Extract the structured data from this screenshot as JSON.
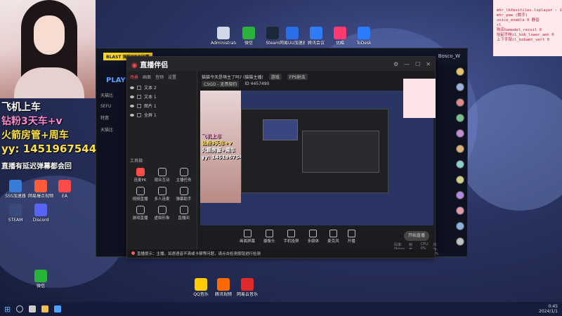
{
  "overlay_text": {
    "line1": "飞机上车",
    "line2": "钻粉3天车+v",
    "line3": "火箭房管+周车",
    "line4": "yy: 1451967544",
    "line5": "直播有延迟弹幕都会回"
  },
  "desktop_icons": [
    {
      "label": "Administrator",
      "color": "#cfd8e6"
    },
    {
      "label": "微信",
      "color": "#2ab33a"
    },
    {
      "label": "Steam",
      "color": "#1b2838"
    },
    {
      "label": "网易UU加速器",
      "color": "#2a6ee8"
    },
    {
      "label": "腾讯会议",
      "color": "#2f7cf6"
    },
    {
      "label": "优酷",
      "color": "#ff3a70"
    },
    {
      "label": "ToDesk",
      "color": "#2a7cff"
    },
    {
      "label": "SSS加速器",
      "color": "#3a7dd8"
    },
    {
      "label": "网易爆点视频",
      "color": "#ff5a3a"
    },
    {
      "label": "EA",
      "color": "#ff4a4a"
    },
    {
      "label": "STEAM",
      "color": "#3a4a7a"
    },
    {
      "label": "Discord",
      "color": "#5865f2"
    },
    {
      "label": "微信",
      "color": "#2ab33a"
    },
    {
      "label": "QQ音乐",
      "color": "#ffcc00"
    },
    {
      "label": "腾讯视频",
      "color": "#ff6a00"
    },
    {
      "label": "网易云音乐",
      "color": "#e02a2a"
    }
  ],
  "main_window": {
    "logo_brand": "直播伴侣",
    "tabs": [
      "场景",
      "画面",
      "音频",
      "设置"
    ],
    "sources": [
      "文本 2",
      "文本 1",
      "图片 1",
      "全屏 1"
    ],
    "tools_heading": "工具箱",
    "tools": [
      {
        "label": "连麦PK",
        "red": true
      },
      {
        "label": "观众互动",
        "red": false
      },
      {
        "label": "主播任务",
        "red": false
      },
      {
        "label": "视频直播",
        "red": false
      },
      {
        "label": "多人连麦",
        "red": false
      },
      {
        "label": "弹幕助手",
        "red": false
      },
      {
        "label": "游戏直播",
        "red": false
      },
      {
        "label": "虚拟形象",
        "red": false
      },
      {
        "label": "直播间",
        "red": false
      }
    ],
    "title_line": "猫猫今天是萌主了吗? (猫猫主播)",
    "tag1": "游戏",
    "tag2": "FPS射击",
    "category": "CSGO - 无畏契约",
    "room_id": "ID 4457490",
    "bottom_tools": [
      "画面屏幕",
      "摄像头",
      "手机投屏",
      "多媒体",
      "麦克风",
      "开播"
    ],
    "start_label": "开始直播",
    "status": [
      "码率: 0kbps",
      "帧率: 0fps",
      "CPU: 0%",
      "内存: 0%"
    ],
    "bottom_bar": "直播提示：主播，如遇语音不清或卡顿等问题，请点击检测按钮进行检测"
  },
  "back_window": {
    "title": "Bosco_W",
    "promo": "BLAST 国际PRO比赛",
    "play_label": "PLAY C",
    "sidebar": [
      "天猫比",
      "SEFU",
      "特惠",
      "天猫比"
    ]
  },
  "notepad_lines": [
    "mhr_lbfexitiles.lsplayer : 1",
    "mhr_paw (数字)",
    "voice_enable 0 静音",
    "cl_",
    "购买hamodel_recoil 0",
    "抬起手枪cl_bob_lower_amt 0",
    "上下手臂cl_bobamt_vert 0"
  ],
  "tray": {
    "time": "0:45",
    "date": "2024/1/1"
  }
}
